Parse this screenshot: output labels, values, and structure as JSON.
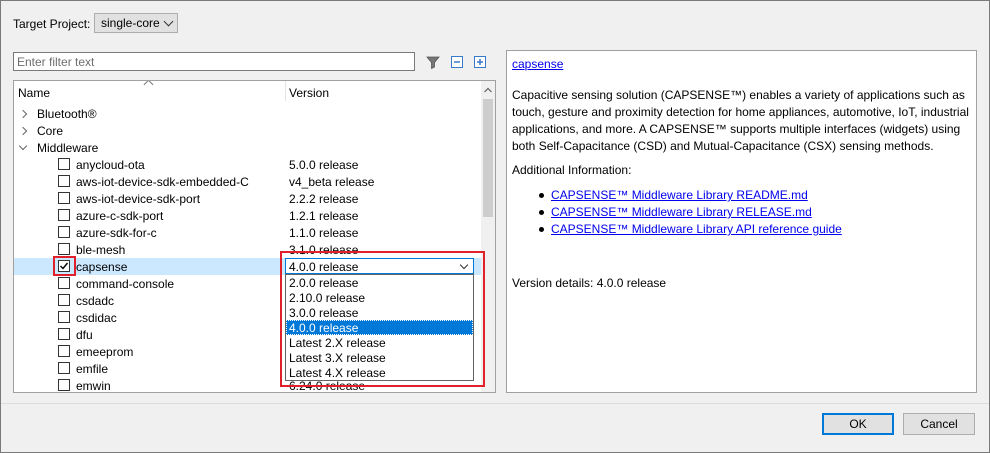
{
  "target_project": {
    "label": "Target Project:",
    "value": "single-core"
  },
  "filter": {
    "placeholder": "Enter filter text"
  },
  "tree": {
    "columns": {
      "name": "Name",
      "version": "Version"
    },
    "rows": [
      {
        "name": "Bluetooth®",
        "version": ""
      },
      {
        "name": "Core",
        "version": ""
      },
      {
        "name": "Middleware",
        "version": ""
      },
      {
        "name": "anycloud-ota",
        "version": "5.0.0 release"
      },
      {
        "name": "aws-iot-device-sdk-embedded-C",
        "version": "v4_beta release"
      },
      {
        "name": "aws-iot-device-sdk-port",
        "version": "2.2.2 release"
      },
      {
        "name": "azure-c-sdk-port",
        "version": "1.2.1 release"
      },
      {
        "name": "azure-sdk-for-c",
        "version": "1.1.0 release"
      },
      {
        "name": "ble-mesh",
        "version": "3.1.0 release"
      },
      {
        "name": "capsense",
        "version": "4.0.0 release"
      },
      {
        "name": "command-console",
        "version": ""
      },
      {
        "name": "csdadc",
        "version": ""
      },
      {
        "name": "csdidac",
        "version": ""
      },
      {
        "name": "dfu",
        "version": ""
      },
      {
        "name": "emeeprom",
        "version": ""
      },
      {
        "name": "emfile",
        "version": ""
      },
      {
        "name": "emwin",
        "version": "6.24.0 release"
      }
    ]
  },
  "version_dropdown": {
    "selected": "4.0.0 release",
    "options": [
      "2.0.0 release",
      "2.10.0 release",
      "3.0.0 release",
      "4.0.0 release",
      "Latest 2.X release",
      "Latest 3.X release",
      "Latest 4.X release"
    ]
  },
  "description": {
    "title": "capsense",
    "body_lines": [
      "Capacitive sensing solution (CAPSENSE™) enables a variety of applications such as",
      "touch, gesture and proximity detection for home appliances, automotive, IoT, industrial",
      "applications, and more. A CAPSENSE™ supports multiple interfaces (widgets) using",
      "both Self-Capacitance (CSD) and Mutual-Capacitance (CSX) sensing methods."
    ],
    "additional_label": "Additional Information:",
    "links": [
      "CAPSENSE™ Middleware Library README.md",
      "CAPSENSE™ Middleware Library RELEASE.md",
      "CAPSENSE™ Middleware Library API reference guide"
    ],
    "version_details": "Version details: 4.0.0 release"
  },
  "buttons": {
    "ok": "OK",
    "cancel": "Cancel"
  },
  "colors": {
    "accent": "#0078d7",
    "highlight": "#e0202a",
    "selected_row": "#cce8ff",
    "link": "#0000ee"
  }
}
